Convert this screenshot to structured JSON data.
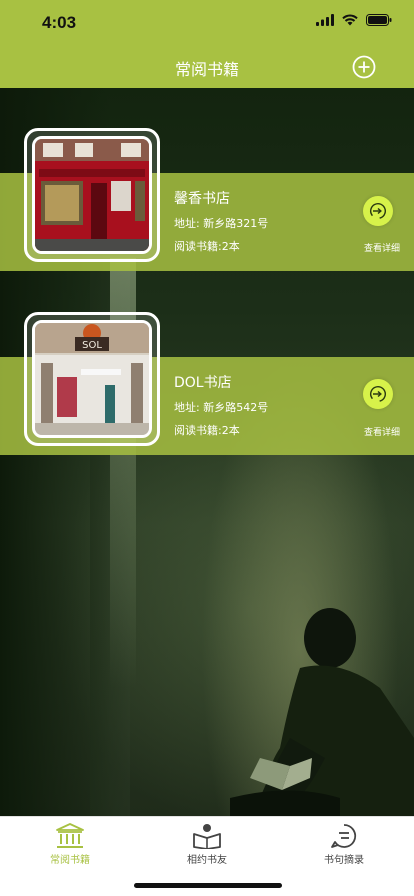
{
  "status": {
    "time": "4:03"
  },
  "nav": {
    "title": "常阅书籍"
  },
  "stores": [
    {
      "name": "馨香书店",
      "address": "地址: 新乡路321号",
      "books": "阅读书籍:2本",
      "detail": "查看详细"
    },
    {
      "name": "DOL书店",
      "address": "地址: 新乡路542号",
      "books": "阅读书籍:2本",
      "detail": "查看详细"
    }
  ],
  "shop_signs": {
    "sign_2": "SOL"
  },
  "tabs": [
    {
      "label": "常阅书籍",
      "icon": "library-icon",
      "active": true
    },
    {
      "label": "相约书友",
      "icon": "reader-icon",
      "active": false
    },
    {
      "label": "书句摘录",
      "icon": "quote-icon",
      "active": false
    }
  ],
  "colors": {
    "accent": "#a8c142",
    "detail_button": "#d7f24a"
  }
}
